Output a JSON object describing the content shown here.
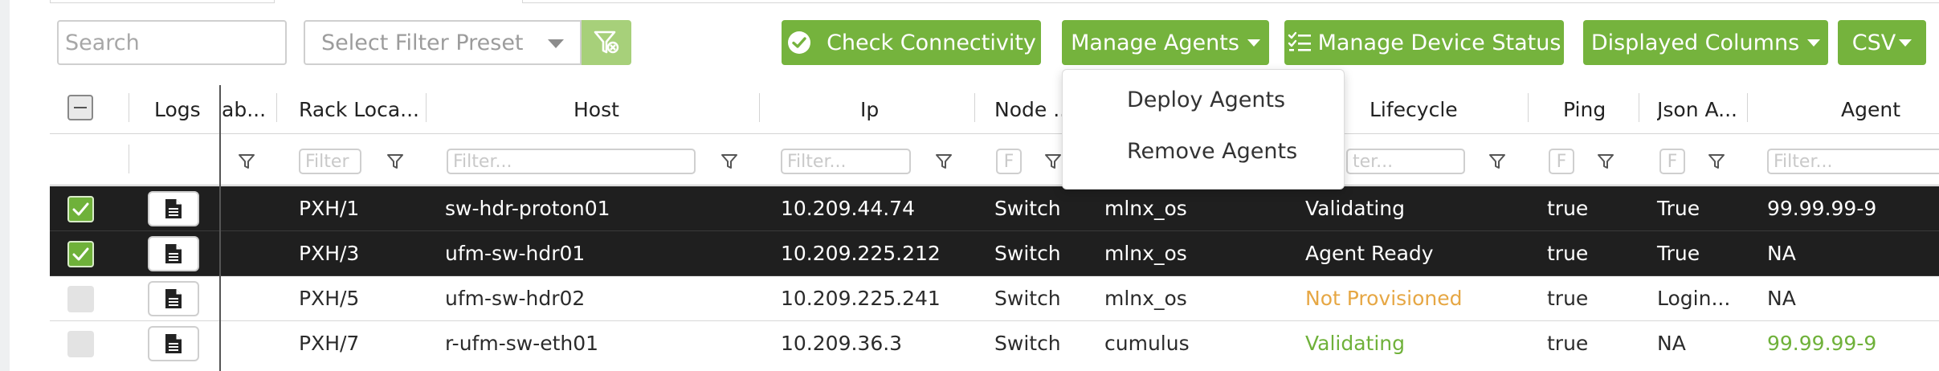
{
  "toolbar": {
    "search_placeholder": "Search",
    "preset_placeholder": "Select Filter Preset",
    "check_connectivity": "Check Connectivity",
    "manage_agents": "Manage Agents",
    "manage_device_status": "Manage Device Status",
    "displayed_columns": "Displayed Columns",
    "csv": "CSV"
  },
  "dropdown": {
    "items": [
      "Deploy Agents",
      "Remove Agents"
    ]
  },
  "columns": {
    "logs": "Logs",
    "lab": "ab...",
    "rack_location": "Rack Loca...",
    "host": "Host",
    "ip": "Ip",
    "node": "Node ...",
    "lifecycle": "Lifecycle",
    "ping": "Ping",
    "json_agent": "Json A...",
    "agent": "Agent"
  },
  "filters": {
    "placeholder_long": "Filter...",
    "placeholder_short": "Filter",
    "placeholder_tiny": "F",
    "lifecycle_partial": "ter..."
  },
  "rows": [
    {
      "selected": true,
      "rack": "PXH/1",
      "host": "sw-hdr-proton01",
      "ip": "10.209.44.74",
      "node": "Switch",
      "os": "mlnx_os",
      "lifecycle": "Validating",
      "lifecycle_color": "#ffffff",
      "ping": "true",
      "json": "True",
      "agent": "99.99.99-9",
      "agent_color": "#ffffff"
    },
    {
      "selected": true,
      "rack": "PXH/3",
      "host": "ufm-sw-hdr01",
      "ip": "10.209.225.212",
      "node": "Switch",
      "os": "mlnx_os",
      "lifecycle": "Agent Ready",
      "lifecycle_color": "#ffffff",
      "ping": "true",
      "json": "True",
      "agent": "NA",
      "agent_color": "#ffffff"
    },
    {
      "selected": false,
      "rack": "PXH/5",
      "host": "ufm-sw-hdr02",
      "ip": "10.209.225.241",
      "node": "Switch",
      "os": "mlnx_os",
      "lifecycle": "Not Provisioned",
      "lifecycle_color": "#e6a744",
      "ping": "true",
      "json": "Login...",
      "agent": "NA",
      "agent_color": "#2b2b2b"
    },
    {
      "selected": false,
      "rack": "PXH/7",
      "host": "r-ufm-sw-eth01",
      "ip": "10.209.36.3",
      "node": "Switch",
      "os": "cumulus",
      "lifecycle": "Validating",
      "lifecycle_color": "#6fb13a",
      "ping": "true",
      "json": "NA",
      "agent": "99.99.99-9",
      "agent_color": "#6fb13a"
    }
  ],
  "colors": {
    "accent_green": "#75b33d",
    "accent_green_light": "#a7d07a",
    "selected_row_bg": "#1f1f1f",
    "warning": "#e6a744",
    "ok": "#6fb13a"
  }
}
